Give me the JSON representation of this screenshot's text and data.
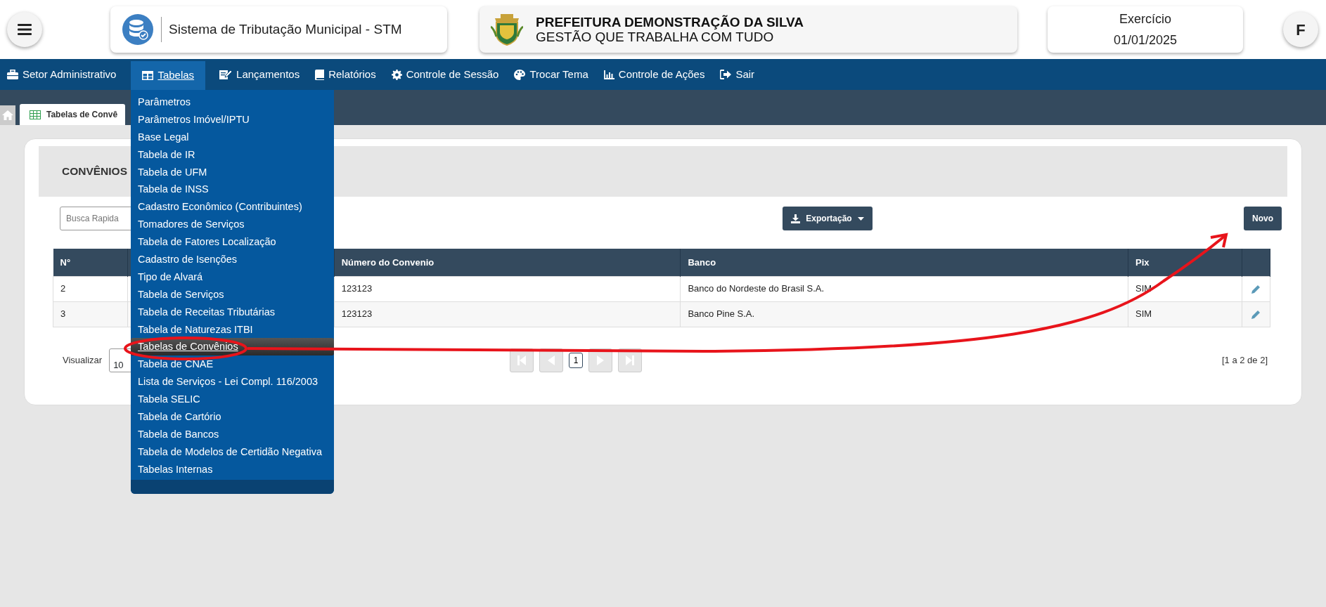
{
  "header": {
    "system_name": "Sistema de Tributação Municipal - STM",
    "org_title": "PREFEITURA DEMONSTRAÇÃO DA SILVA",
    "org_subtitle": "GESTÃO QUE TRABALHA COM TUDO",
    "exercise_label": "Exercício",
    "exercise_date": "01/01/2025",
    "user_initial": "F"
  },
  "nav": [
    {
      "label": "Setor Administrativo",
      "selected": false
    },
    {
      "label": "Tabelas",
      "selected": true
    },
    {
      "label": "Lançamentos",
      "selected": false
    },
    {
      "label": "Relatórios",
      "selected": false
    },
    {
      "label": "Controle de Sessão",
      "selected": false
    },
    {
      "label": "Trocar Tema",
      "selected": false
    },
    {
      "label": "Controle de Ações",
      "selected": false
    },
    {
      "label": "Sair",
      "selected": false
    }
  ],
  "dropdown": [
    {
      "label": "Parâmetros",
      "selected": false
    },
    {
      "label": "Parâmetros Imóvel/IPTU",
      "selected": false
    },
    {
      "label": "Base Legal",
      "selected": false
    },
    {
      "label": "Tabela de IR",
      "selected": false
    },
    {
      "label": "Tabela de UFM",
      "selected": false
    },
    {
      "label": "Tabela de INSS",
      "selected": false
    },
    {
      "label": "Cadastro Econômico (Contribuintes)",
      "selected": false
    },
    {
      "label": "Tomadores de Serviços",
      "selected": false
    },
    {
      "label": "Tabela de Fatores Localização",
      "selected": false
    },
    {
      "label": "Cadastro de Isenções",
      "selected": false
    },
    {
      "label": "Tipo de Alvará",
      "selected": false
    },
    {
      "label": "Tabela de Serviços",
      "selected": false
    },
    {
      "label": "Tabela de Receitas Tributárias",
      "selected": false
    },
    {
      "label": "Tabela de Naturezas ITBI",
      "selected": false
    },
    {
      "label": "Tabelas de Convênios",
      "selected": true
    },
    {
      "label": "Tabela de CNAE",
      "selected": false
    },
    {
      "label": "Lista de Serviços - Lei Compl. 116/2003",
      "selected": false
    },
    {
      "label": "Tabela SELIC",
      "selected": false
    },
    {
      "label": "Tabela de Cartório",
      "selected": false
    },
    {
      "label": "Tabela de Bancos",
      "selected": false
    },
    {
      "label": "Tabela de Modelos de Certidão Negativa",
      "selected": false
    },
    {
      "label": "Tabelas Internas",
      "selected": false
    }
  ],
  "tabs": [
    {
      "label": "Tabelas de Convê",
      "selected": true
    }
  ],
  "page": {
    "title": "CONVÊNIOS",
    "search": {
      "placeholder": "Busca Rapida"
    },
    "export_button": "Exportação",
    "new_button": "Novo",
    "table": {
      "columns": [
        "N°",
        "Número do Convenio",
        "Banco",
        "Pix"
      ],
      "rows": [
        {
          "cells": [
            "2",
            "123123",
            "Banco do Nordeste do Brasil S.A.",
            "SIM"
          ]
        },
        {
          "cells": [
            "3",
            "123123",
            "Banco Pine S.A.",
            "SIM"
          ]
        }
      ]
    },
    "pagination": {
      "view_label": "Visualizar",
      "page_size": "10",
      "nav_disabled": true,
      "pages": [
        {
          "label": "1",
          "selected": true
        }
      ],
      "summary": "[1 a 2 de 2]"
    }
  },
  "annotations": {
    "circle": {
      "color": "#e8141b"
    },
    "arrow": {
      "color": "#e8141b"
    }
  }
}
